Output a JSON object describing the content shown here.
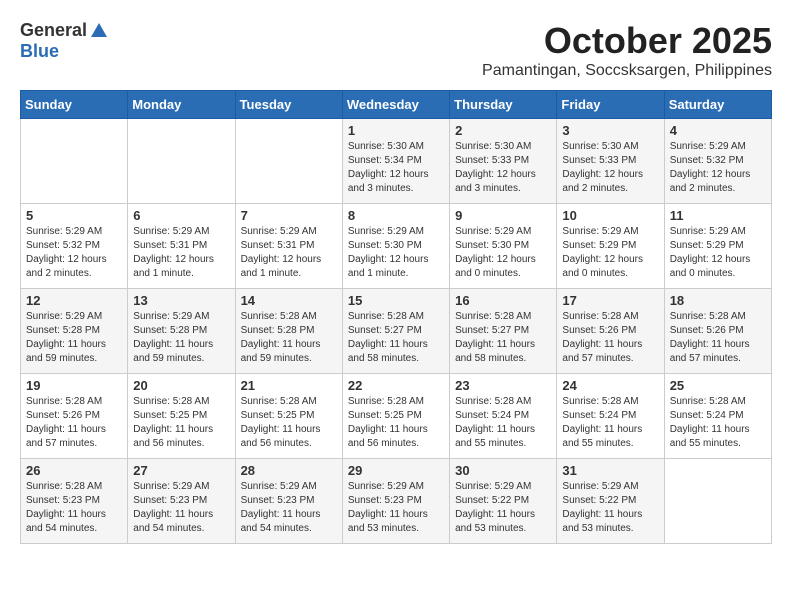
{
  "header": {
    "logo_general": "General",
    "logo_blue": "Blue",
    "month": "October 2025",
    "location": "Pamantingan, Soccsksargen, Philippines"
  },
  "weekdays": [
    "Sunday",
    "Monday",
    "Tuesday",
    "Wednesday",
    "Thursday",
    "Friday",
    "Saturday"
  ],
  "weeks": [
    [
      {
        "day": "",
        "sunrise": "",
        "sunset": "",
        "daylight": ""
      },
      {
        "day": "",
        "sunrise": "",
        "sunset": "",
        "daylight": ""
      },
      {
        "day": "",
        "sunrise": "",
        "sunset": "",
        "daylight": ""
      },
      {
        "day": "1",
        "sunrise": "Sunrise: 5:30 AM",
        "sunset": "Sunset: 5:34 PM",
        "daylight": "Daylight: 12 hours and 3 minutes."
      },
      {
        "day": "2",
        "sunrise": "Sunrise: 5:30 AM",
        "sunset": "Sunset: 5:33 PM",
        "daylight": "Daylight: 12 hours and 3 minutes."
      },
      {
        "day": "3",
        "sunrise": "Sunrise: 5:30 AM",
        "sunset": "Sunset: 5:33 PM",
        "daylight": "Daylight: 12 hours and 2 minutes."
      },
      {
        "day": "4",
        "sunrise": "Sunrise: 5:29 AM",
        "sunset": "Sunset: 5:32 PM",
        "daylight": "Daylight: 12 hours and 2 minutes."
      }
    ],
    [
      {
        "day": "5",
        "sunrise": "Sunrise: 5:29 AM",
        "sunset": "Sunset: 5:32 PM",
        "daylight": "Daylight: 12 hours and 2 minutes."
      },
      {
        "day": "6",
        "sunrise": "Sunrise: 5:29 AM",
        "sunset": "Sunset: 5:31 PM",
        "daylight": "Daylight: 12 hours and 1 minute."
      },
      {
        "day": "7",
        "sunrise": "Sunrise: 5:29 AM",
        "sunset": "Sunset: 5:31 PM",
        "daylight": "Daylight: 12 hours and 1 minute."
      },
      {
        "day": "8",
        "sunrise": "Sunrise: 5:29 AM",
        "sunset": "Sunset: 5:30 PM",
        "daylight": "Daylight: 12 hours and 1 minute."
      },
      {
        "day": "9",
        "sunrise": "Sunrise: 5:29 AM",
        "sunset": "Sunset: 5:30 PM",
        "daylight": "Daylight: 12 hours and 0 minutes."
      },
      {
        "day": "10",
        "sunrise": "Sunrise: 5:29 AM",
        "sunset": "Sunset: 5:29 PM",
        "daylight": "Daylight: 12 hours and 0 minutes."
      },
      {
        "day": "11",
        "sunrise": "Sunrise: 5:29 AM",
        "sunset": "Sunset: 5:29 PM",
        "daylight": "Daylight: 12 hours and 0 minutes."
      }
    ],
    [
      {
        "day": "12",
        "sunrise": "Sunrise: 5:29 AM",
        "sunset": "Sunset: 5:28 PM",
        "daylight": "Daylight: 11 hours and 59 minutes."
      },
      {
        "day": "13",
        "sunrise": "Sunrise: 5:29 AM",
        "sunset": "Sunset: 5:28 PM",
        "daylight": "Daylight: 11 hours and 59 minutes."
      },
      {
        "day": "14",
        "sunrise": "Sunrise: 5:28 AM",
        "sunset": "Sunset: 5:28 PM",
        "daylight": "Daylight: 11 hours and 59 minutes."
      },
      {
        "day": "15",
        "sunrise": "Sunrise: 5:28 AM",
        "sunset": "Sunset: 5:27 PM",
        "daylight": "Daylight: 11 hours and 58 minutes."
      },
      {
        "day": "16",
        "sunrise": "Sunrise: 5:28 AM",
        "sunset": "Sunset: 5:27 PM",
        "daylight": "Daylight: 11 hours and 58 minutes."
      },
      {
        "day": "17",
        "sunrise": "Sunrise: 5:28 AM",
        "sunset": "Sunset: 5:26 PM",
        "daylight": "Daylight: 11 hours and 57 minutes."
      },
      {
        "day": "18",
        "sunrise": "Sunrise: 5:28 AM",
        "sunset": "Sunset: 5:26 PM",
        "daylight": "Daylight: 11 hours and 57 minutes."
      }
    ],
    [
      {
        "day": "19",
        "sunrise": "Sunrise: 5:28 AM",
        "sunset": "Sunset: 5:26 PM",
        "daylight": "Daylight: 11 hours and 57 minutes."
      },
      {
        "day": "20",
        "sunrise": "Sunrise: 5:28 AM",
        "sunset": "Sunset: 5:25 PM",
        "daylight": "Daylight: 11 hours and 56 minutes."
      },
      {
        "day": "21",
        "sunrise": "Sunrise: 5:28 AM",
        "sunset": "Sunset: 5:25 PM",
        "daylight": "Daylight: 11 hours and 56 minutes."
      },
      {
        "day": "22",
        "sunrise": "Sunrise: 5:28 AM",
        "sunset": "Sunset: 5:25 PM",
        "daylight": "Daylight: 11 hours and 56 minutes."
      },
      {
        "day": "23",
        "sunrise": "Sunrise: 5:28 AM",
        "sunset": "Sunset: 5:24 PM",
        "daylight": "Daylight: 11 hours and 55 minutes."
      },
      {
        "day": "24",
        "sunrise": "Sunrise: 5:28 AM",
        "sunset": "Sunset: 5:24 PM",
        "daylight": "Daylight: 11 hours and 55 minutes."
      },
      {
        "day": "25",
        "sunrise": "Sunrise: 5:28 AM",
        "sunset": "Sunset: 5:24 PM",
        "daylight": "Daylight: 11 hours and 55 minutes."
      }
    ],
    [
      {
        "day": "26",
        "sunrise": "Sunrise: 5:28 AM",
        "sunset": "Sunset: 5:23 PM",
        "daylight": "Daylight: 11 hours and 54 minutes."
      },
      {
        "day": "27",
        "sunrise": "Sunrise: 5:29 AM",
        "sunset": "Sunset: 5:23 PM",
        "daylight": "Daylight: 11 hours and 54 minutes."
      },
      {
        "day": "28",
        "sunrise": "Sunrise: 5:29 AM",
        "sunset": "Sunset: 5:23 PM",
        "daylight": "Daylight: 11 hours and 54 minutes."
      },
      {
        "day": "29",
        "sunrise": "Sunrise: 5:29 AM",
        "sunset": "Sunset: 5:23 PM",
        "daylight": "Daylight: 11 hours and 53 minutes."
      },
      {
        "day": "30",
        "sunrise": "Sunrise: 5:29 AM",
        "sunset": "Sunset: 5:22 PM",
        "daylight": "Daylight: 11 hours and 53 minutes."
      },
      {
        "day": "31",
        "sunrise": "Sunrise: 5:29 AM",
        "sunset": "Sunset: 5:22 PM",
        "daylight": "Daylight: 11 hours and 53 minutes."
      },
      {
        "day": "",
        "sunrise": "",
        "sunset": "",
        "daylight": ""
      }
    ]
  ]
}
